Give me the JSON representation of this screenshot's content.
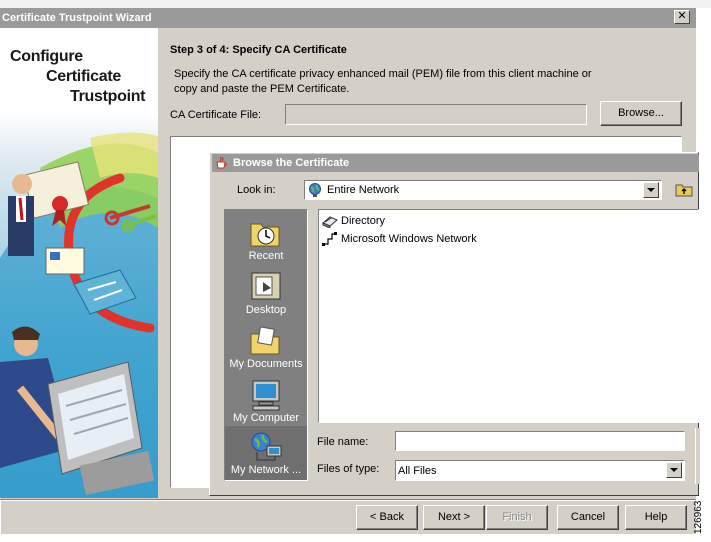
{
  "window": {
    "title": "Certificate Trustpoint Wizard",
    "close_glyph": "✕"
  },
  "banner": {
    "line1": "Configure",
    "line2": "Certificate",
    "line3": "Trustpoint"
  },
  "step": {
    "title": "Step 3 of 4: Specify CA Certificate",
    "description": "Specify the CA certificate privacy enhanced mail (PEM) file from this client machine or copy and paste the PEM Certificate."
  },
  "ca_file": {
    "label": "CA Certificate File:",
    "value": "",
    "browse_label": "Browse..."
  },
  "pem_text": "",
  "nav": {
    "back": "< Back",
    "next": "Next >",
    "finish": "Finish",
    "cancel": "Cancel",
    "help": "Help"
  },
  "browse_dialog": {
    "title": "Browse the Certificate",
    "look_in_label": "Look in:",
    "look_in_value": "Entire Network",
    "places": [
      {
        "label": "Recent",
        "icon": "recent-folder-icon"
      },
      {
        "label": "Desktop",
        "icon": "desktop-icon"
      },
      {
        "label": "My Documents",
        "icon": "my-documents-icon"
      },
      {
        "label": "My Computer",
        "icon": "my-computer-icon"
      },
      {
        "label": "My Network ...",
        "icon": "my-network-icon"
      }
    ],
    "files": [
      {
        "name": "Directory",
        "icon": "directory-icon"
      },
      {
        "name": "Microsoft Windows Network",
        "icon": "windows-network-icon"
      }
    ],
    "file_name_label": "File name:",
    "file_name_value": "",
    "file_type_label": "Files of type:",
    "file_type_value": "All Files"
  },
  "figure_id": "126963",
  "colors": {
    "titlebar": "#9a9a9a",
    "dialog_face": "#d4d0c8",
    "places_bar": "#808080",
    "banner_blue": "#2f95c5"
  }
}
